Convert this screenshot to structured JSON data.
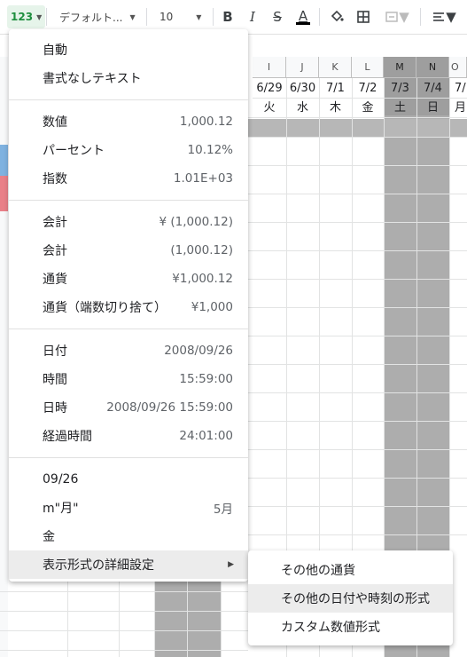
{
  "toolbar": {
    "format_button": "123",
    "font_name": "デフォルト...",
    "font_size": "10",
    "bold": "B",
    "italic": "I",
    "strike": "S",
    "text_color": "A"
  },
  "columns": [
    "I",
    "J",
    "K",
    "L",
    "M",
    "N",
    "O"
  ],
  "dates": [
    "6/29",
    "6/30",
    "7/1",
    "7/2",
    "7/3",
    "7/4",
    "7/"
  ],
  "weekdays": [
    "火",
    "水",
    "木",
    "金",
    "土",
    "日",
    "月"
  ],
  "colors": {
    "weekend_shade": "#adadad",
    "format_button_bg": "#e6f4ea",
    "highlight": "#ececec"
  },
  "menu": {
    "group1": [
      {
        "label": "自動",
        "value": ""
      },
      {
        "label": "書式なしテキスト",
        "value": ""
      }
    ],
    "group2": [
      {
        "label": "数値",
        "value": "1,000.12"
      },
      {
        "label": "パーセント",
        "value": "10.12%"
      },
      {
        "label": "指数",
        "value": "1.01E+03"
      }
    ],
    "group3": [
      {
        "label": "会計",
        "value": "¥ (1,000.12)"
      },
      {
        "label": "会計",
        "value": "(1,000.12)"
      },
      {
        "label": "通貨",
        "value": "¥1,000.12"
      },
      {
        "label": "通貨（端数切り捨て）",
        "value": "¥1,000"
      }
    ],
    "group4": [
      {
        "label": "日付",
        "value": "2008/09/26"
      },
      {
        "label": "時間",
        "value": "15:59:00"
      },
      {
        "label": "日時",
        "value": "2008/09/26 15:59:00"
      },
      {
        "label": "経過時間",
        "value": "24:01:00"
      }
    ],
    "group5": [
      {
        "label": "09/26",
        "value": ""
      },
      {
        "label": "m\"月\"",
        "value": "5月"
      },
      {
        "label": "金",
        "value": ""
      }
    ],
    "more_formats": "表示形式の詳細設定"
  },
  "submenu": [
    "その他の通貨",
    "その他の日付や時刻の形式",
    "カスタム数値形式"
  ]
}
